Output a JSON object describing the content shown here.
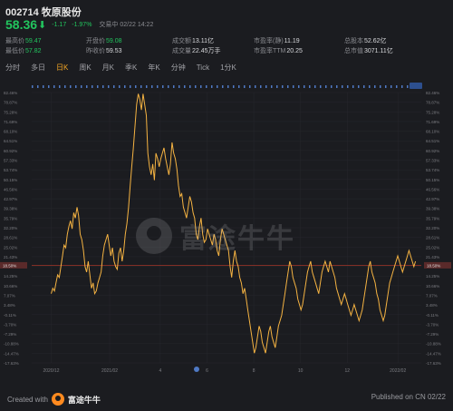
{
  "header": {
    "title": "002714 牧原股份",
    "price": "58.36",
    "change": "-1.17",
    "change_pct": "-1.97%",
    "status": "交易中 02/22 14:22",
    "stats": [
      {
        "label": "最高价",
        "value": "59.47",
        "color": "green"
      },
      {
        "label": "开盘价",
        "value": "59.08",
        "color": "green"
      },
      {
        "label": "成交额",
        "value": "13.11亿",
        "color": ""
      },
      {
        "label": "市盈率(静)",
        "value": "11.19",
        "color": ""
      },
      {
        "label": "总股本",
        "value": "52.62亿",
        "color": ""
      },
      {
        "label": "最低价",
        "value": "57.82",
        "color": "green"
      },
      {
        "label": "昨收价",
        "value": "59.53",
        "color": ""
      },
      {
        "label": "成交量",
        "value": "22.45万手",
        "color": ""
      },
      {
        "label": "市盈率TTM",
        "value": "20.25",
        "color": ""
      },
      {
        "label": "总市值",
        "value": "3071.11亿",
        "color": ""
      }
    ]
  },
  "tabs": [
    "分时",
    "多日",
    "日K",
    "周K",
    "月K",
    "季K",
    "年K",
    "分钟",
    "Tick",
    "1分K"
  ],
  "active_tab": "日K",
  "chart_data": {
    "type": "line",
    "y_ticks_left": [
      "82.46%",
      "78.87%",
      "75.28%",
      "71.69%",
      "68.10%",
      "64.51%",
      "60.92%",
      "57.33%",
      "53.74%",
      "50.15%",
      "46.56%",
      "42.97%",
      "39.38%",
      "35.79%",
      "32.20%",
      "28.61%",
      "25.02%",
      "21.43%",
      "17.84%",
      "14.25%",
      "10.66%",
      "7.07%",
      "3.48%",
      "-0.11%",
      "-3.70%",
      "-7.29%",
      "-10.88%",
      "-14.47%",
      "-17.63%"
    ],
    "y_ticks_right": [
      "82.46%",
      "78.87%",
      "75.28%",
      "71.69%",
      "68.10%",
      "64.51%",
      "60.92%",
      "57.33%",
      "53.74%",
      "50.15%",
      "46.56%",
      "42.97%",
      "39.38%",
      "35.79%",
      "32.20%",
      "28.61%",
      "25.02%",
      "21.43%",
      "17.84%",
      "14.25%",
      "10.66%",
      "7.07%",
      "3.48%",
      "-0.11%",
      "-3.70%",
      "-7.29%",
      "-10.88%",
      "-14.47%",
      "-17.63%"
    ],
    "ylim": [
      -17.63,
      82.46
    ],
    "baseline": 18.5,
    "baseline_label": "18.50%",
    "x_ticks": [
      {
        "label": "2020/12",
        "t": 0.05
      },
      {
        "label": "2021/02",
        "t": 0.2
      },
      {
        "label": "4",
        "t": 0.33
      },
      {
        "label": "6",
        "t": 0.45
      },
      {
        "label": "8",
        "t": 0.57
      },
      {
        "label": "10",
        "t": 0.69
      },
      {
        "label": "12",
        "t": 0.81
      },
      {
        "label": "2022/02",
        "t": 0.94
      }
    ],
    "values": [
      8,
      10,
      9,
      12,
      15,
      14,
      18,
      22,
      26,
      25,
      30,
      33,
      35,
      32,
      38,
      36,
      40,
      37,
      30,
      28,
      24,
      18,
      16,
      20,
      15,
      10,
      12,
      8,
      9,
      12,
      14,
      16,
      22,
      26,
      28,
      30,
      26,
      22,
      25,
      20,
      18,
      17,
      23,
      25,
      20,
      24,
      30,
      34,
      40,
      48,
      55,
      62,
      70,
      78,
      82,
      80,
      76,
      82,
      78,
      74,
      60,
      55,
      52,
      56,
      50,
      60,
      58,
      55,
      58,
      60,
      62,
      58,
      55,
      52,
      56,
      64,
      60,
      58,
      54,
      48,
      44,
      45,
      40,
      38,
      36,
      40,
      44,
      42,
      38,
      36,
      30,
      28,
      33,
      36,
      30,
      27,
      28,
      32,
      30,
      28,
      26,
      30,
      28,
      24,
      22,
      28,
      32,
      30,
      28,
      26,
      24,
      18,
      14,
      20,
      24,
      20,
      18,
      14,
      12,
      8,
      10,
      6,
      2,
      -2,
      -6,
      -10,
      -14,
      -12,
      -8,
      -4,
      -6,
      -10,
      -12,
      -14,
      -10,
      -6,
      -4,
      -8,
      -10,
      -12,
      -8,
      -4,
      -2,
      0,
      4,
      8,
      12,
      16,
      20,
      18,
      14,
      12,
      10,
      6,
      4,
      2,
      4,
      8,
      12,
      16,
      18,
      20,
      16,
      14,
      12,
      10,
      8,
      12,
      16,
      18,
      20,
      18,
      16,
      20,
      18,
      16,
      14,
      10,
      8,
      6,
      4,
      6,
      8,
      6,
      4,
      2,
      0,
      2,
      4,
      2,
      0,
      -2,
      0,
      2,
      6,
      10,
      14,
      18,
      20,
      16,
      14,
      12,
      8,
      6,
      2,
      0,
      -2,
      0,
      4,
      8,
      12,
      14,
      16,
      18,
      20,
      22,
      20,
      18,
      16,
      18,
      20,
      22,
      24,
      22,
      20,
      18,
      20
    ]
  },
  "watermark": "富途牛牛",
  "footer": {
    "created": "Created with",
    "brand": "富途牛牛",
    "published": "Published on CN 02/22"
  }
}
